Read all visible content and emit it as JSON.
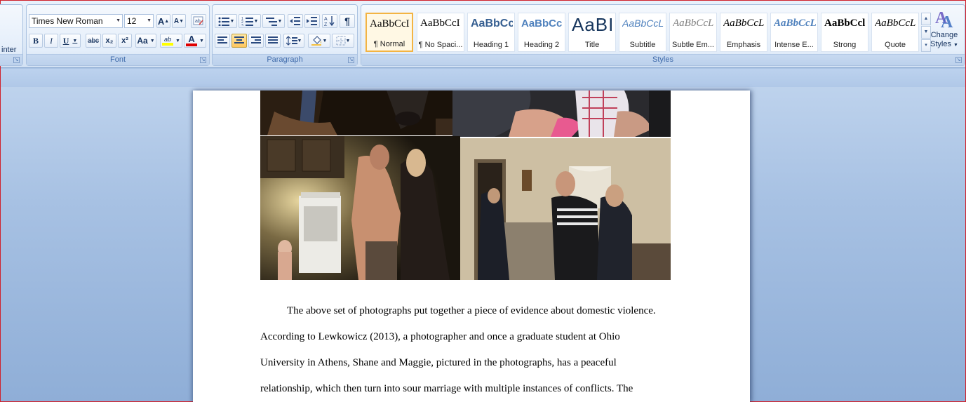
{
  "clipboard": {
    "format_painter_label": "inter"
  },
  "font": {
    "group_label": "Font",
    "name": "Times New Roman",
    "size": "12",
    "grow_label": "A",
    "shrink_label": "A",
    "bold": "B",
    "italic": "I",
    "underline": "U",
    "strike": "abc",
    "subscript": "x₂",
    "superscript": "x²",
    "change_case": "Aa",
    "highlight": "ab",
    "font_color": "A",
    "highlight_color": "#ffff00",
    "font_color_value": "#e00000"
  },
  "paragraph": {
    "group_label": "Paragraph",
    "pilcrow": "¶"
  },
  "styles": {
    "group_label": "Styles",
    "items": [
      {
        "sample": "AaBbCcI",
        "name": "¶ Normal"
      },
      {
        "sample": "AaBbCcI",
        "name": "¶ No Spaci..."
      },
      {
        "sample": "AaBbCc",
        "name": "Heading 1"
      },
      {
        "sample": "AaBbCc",
        "name": "Heading 2"
      },
      {
        "sample": "AaBI",
        "name": "Title"
      },
      {
        "sample": "AaBbCcL",
        "name": "Subtitle"
      },
      {
        "sample": "AaBbCcL",
        "name": "Subtle Em..."
      },
      {
        "sample": "AaBbCcL",
        "name": "Emphasis"
      },
      {
        "sample": "AaBbCcL",
        "name": "Intense E..."
      },
      {
        "sample": "AaBbCcl",
        "name": "Strong"
      },
      {
        "sample": "AaBbCcL",
        "name": "Quote"
      }
    ],
    "change_styles_line1": "Change",
    "change_styles_line2": "Styles"
  },
  "document": {
    "lines": [
      "The above set of photographs put together a piece of evidence about domestic violence.",
      "According to Lewkowicz (2013), a photographer and once a graduate student at Ohio",
      "University in Athens, Shane and Maggie, pictured in the photographs, has a peaceful",
      "relationship, which then turn into sour marriage with multiple instances of conflicts. The"
    ]
  }
}
